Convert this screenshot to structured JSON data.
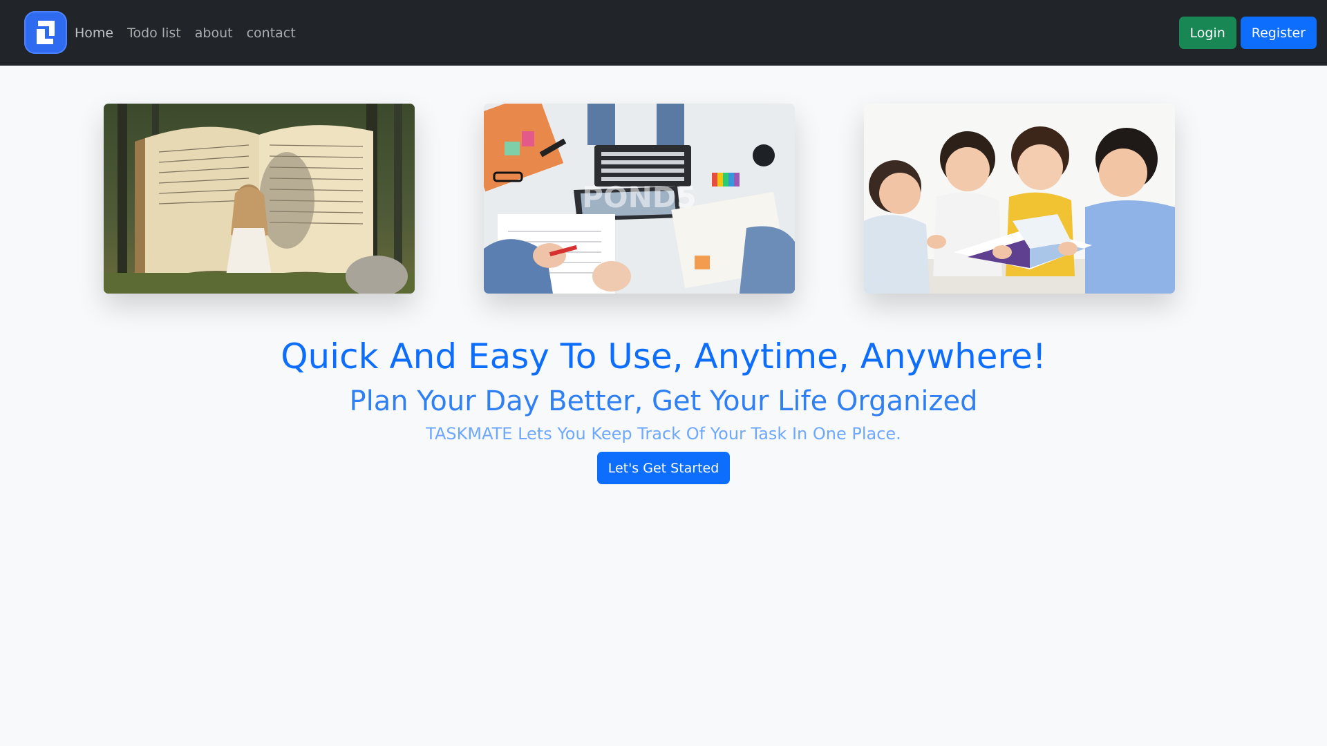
{
  "navbar": {
    "logo_icon": "app-logo-icon",
    "links": [
      {
        "label": "Home"
      },
      {
        "label": "Todo list"
      },
      {
        "label": "about"
      },
      {
        "label": "contact"
      }
    ],
    "login_label": "Login",
    "register_label": "Register",
    "colors": {
      "background": "#212529",
      "login": "#198754",
      "register": "#0d6efd"
    }
  },
  "gallery": {
    "images": [
      {
        "description": "girl-walking-into-giant-book-in-forest"
      },
      {
        "description": "people-working-on-laptop-and-notes-desk",
        "watermark": "POND5"
      },
      {
        "description": "children-reading-book-together"
      }
    ]
  },
  "hero": {
    "title": "Quick And Easy To Use, Anytime, Anywhere!",
    "subtitle": "Plan Your Day Better, Get Your Life Organized",
    "tagline": "TASKMATE Lets You Keep Track Of Your Task In One Place.",
    "cta_label": "Let's Get Started",
    "colors": {
      "title": "#0d6efd",
      "subtitle": "#2f7ff5",
      "tagline": "#6ea8fe"
    }
  }
}
